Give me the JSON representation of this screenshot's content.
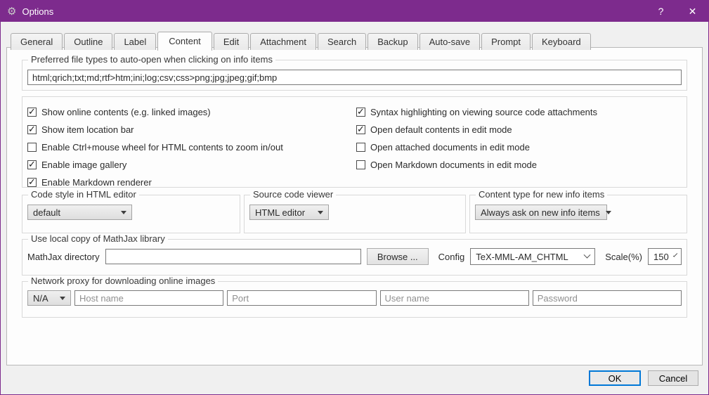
{
  "titlebar": {
    "title": "Options",
    "help": "?",
    "close": "✕"
  },
  "tabs": [
    {
      "label": "General",
      "active": false
    },
    {
      "label": "Outline",
      "active": false
    },
    {
      "label": "Label",
      "active": false
    },
    {
      "label": "Content",
      "active": true
    },
    {
      "label": "Edit",
      "active": false
    },
    {
      "label": "Attachment",
      "active": false
    },
    {
      "label": "Search",
      "active": false
    },
    {
      "label": "Backup",
      "active": false
    },
    {
      "label": "Auto-save",
      "active": false
    },
    {
      "label": "Prompt",
      "active": false
    },
    {
      "label": "Keyboard",
      "active": false
    }
  ],
  "file_types": {
    "group_label": "Preferred file types to auto-open when clicking on info items",
    "value": "html;qrich;txt;md;rtf>htm;ini;log;csv;css>png;jpg;jpeg;gif;bmp"
  },
  "options": {
    "left": [
      {
        "label": "Show online contents (e.g. linked images)",
        "checked": true
      },
      {
        "label": "Show item location bar",
        "checked": true
      },
      {
        "label": "Enable Ctrl+mouse wheel for HTML contents to zoom in/out",
        "checked": false
      },
      {
        "label": "Enable image gallery",
        "checked": true
      },
      {
        "label": "Enable Markdown renderer",
        "checked": true
      }
    ],
    "right": [
      {
        "label": "Syntax highlighting on viewing source code attachments",
        "checked": true
      },
      {
        "label": "Open default contents in edit mode",
        "checked": true
      },
      {
        "label": "Open attached documents in edit mode",
        "checked": false
      },
      {
        "label": "Open Markdown documents in edit mode",
        "checked": false
      }
    ]
  },
  "code_style": {
    "group_label": "Code style in HTML editor",
    "value": "default"
  },
  "source_viewer": {
    "group_label": "Source code viewer",
    "value": "HTML editor"
  },
  "content_type": {
    "group_label": "Content type for new info items",
    "value": "Always ask on new info items"
  },
  "mathjax": {
    "group_label": "Use local copy of MathJax library",
    "dir_label": "MathJax directory",
    "dir_value": "",
    "browse_label": "Browse ...",
    "config_label": "Config",
    "config_value": "TeX-MML-AM_CHTML",
    "scale_label": "Scale(%)",
    "scale_value": "150"
  },
  "proxy": {
    "group_label": "Network proxy for downloading online images",
    "type_value": "N/A",
    "host_placeholder": "Host name",
    "port_placeholder": "Port",
    "user_placeholder": "User name",
    "password_placeholder": "Password"
  },
  "footer": {
    "ok": "OK",
    "cancel": "Cancel"
  },
  "colors": {
    "titlebar": "#7d2b8d",
    "focus_accent": "#0078d7",
    "tab_page_bg": "#fdfdfd"
  }
}
